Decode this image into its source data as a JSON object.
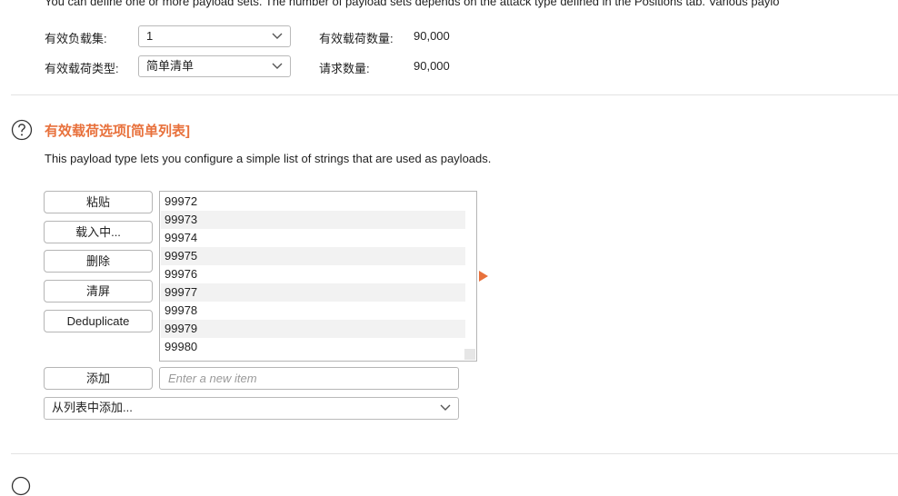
{
  "top_description": "You can define one or more payload sets. The number of payload sets depends on the attack type defined in the Positions tab. Various paylo",
  "payload_set": {
    "label": "有效负载集:",
    "value": "1"
  },
  "payload_count": {
    "label": "有效载荷数量:",
    "value": "90,000"
  },
  "payload_type": {
    "label": "有效载荷类型:",
    "value": "简单清单"
  },
  "request_count": {
    "label": "请求数量:",
    "value": "90,000"
  },
  "section": {
    "title": "有效载荷选项[简单列表]",
    "description": "This payload type lets you configure a simple list of strings that are used as payloads."
  },
  "buttons": {
    "paste": "粘贴",
    "load": "载入中...",
    "remove": "删除",
    "clear": "清屏",
    "deduplicate": "Deduplicate",
    "add": "添加"
  },
  "list_items": [
    "99972",
    "99973",
    "99974",
    "99975",
    "99976",
    "99977",
    "99978",
    "99979",
    "99980"
  ],
  "new_item": {
    "placeholder": "Enter a new item",
    "value": ""
  },
  "add_from_list": {
    "value": "从列表中添加..."
  },
  "colors": {
    "accent": "#e8713c",
    "row_alt": "#f2f2f2",
    "border": "#b5b5b5"
  },
  "icons": [
    "help-icon",
    "chevron-down-icon",
    "arrow-right-icon"
  ]
}
